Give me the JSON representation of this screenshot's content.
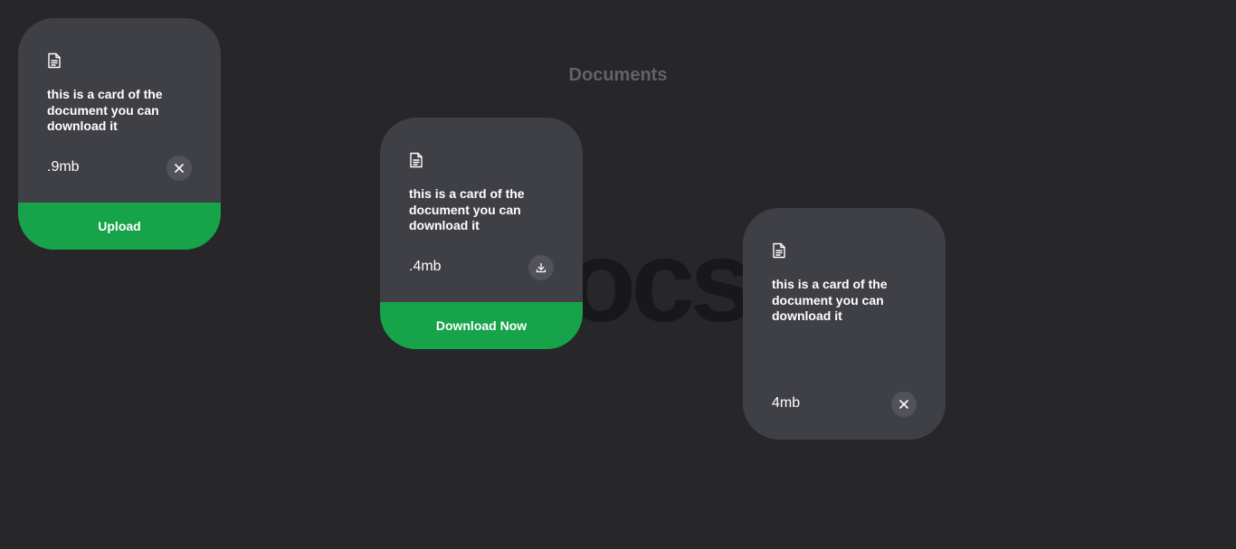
{
  "page": {
    "heading": "Documents",
    "watermark": "Docs"
  },
  "colors": {
    "background": "#27272a",
    "card": "#3f3f46",
    "accent": "#16a34a",
    "heading": "#636366",
    "icon_button": "#52525b"
  },
  "cards": [
    {
      "icon": "file-text-icon",
      "description": "this is a card of the document you can download it",
      "size": ".9mb",
      "action_icon": "close-icon",
      "footer_label": "Upload"
    },
    {
      "icon": "file-text-icon",
      "description": "this is a card of the document you can download it",
      "size": ".4mb",
      "action_icon": "download-icon",
      "footer_label": "Download Now"
    },
    {
      "icon": "file-text-icon",
      "description": "this is a card of the document you can download it",
      "size": "4mb",
      "action_icon": "close-icon"
    }
  ]
}
